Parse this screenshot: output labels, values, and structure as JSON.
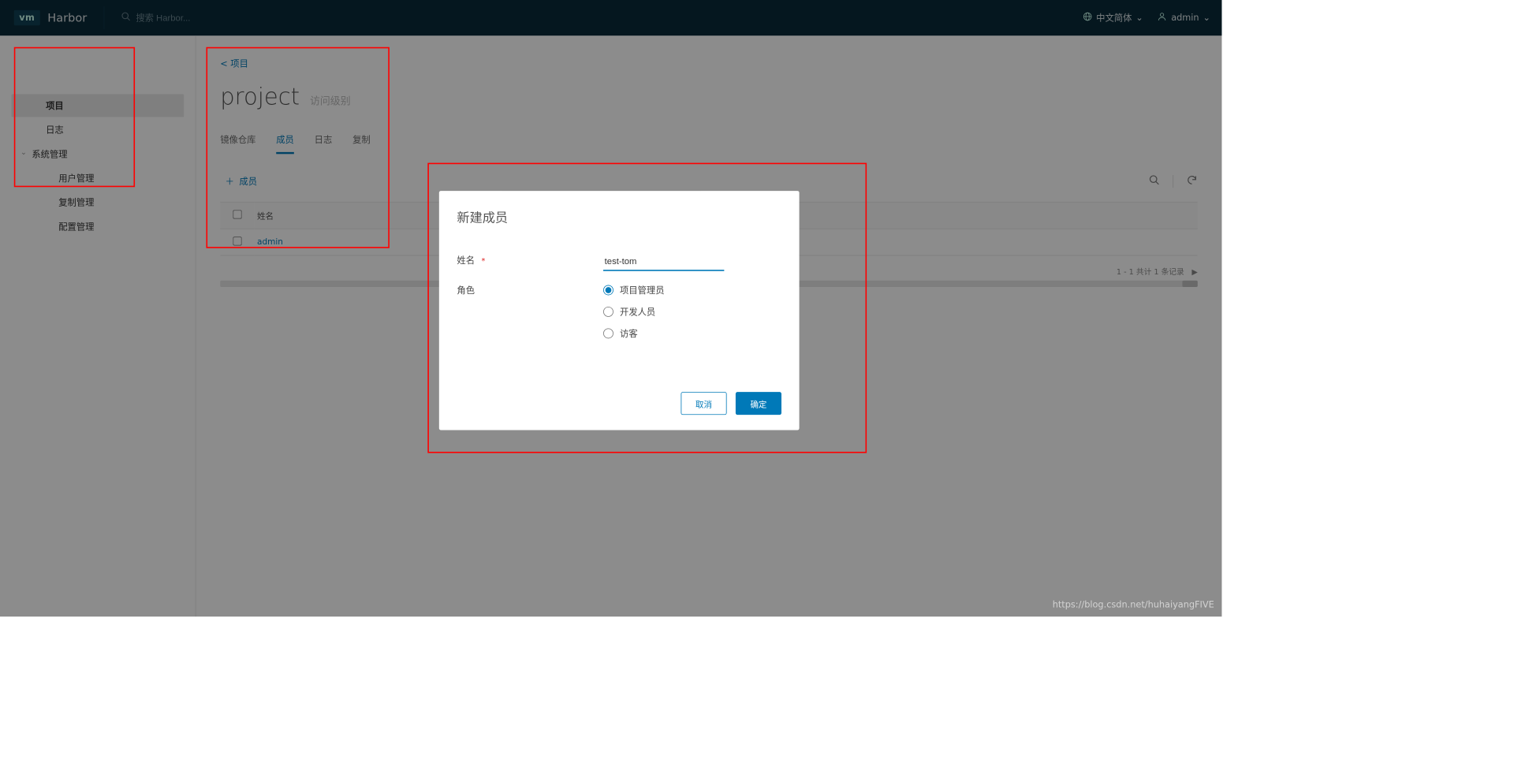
{
  "header": {
    "logo_text": "vm",
    "app_title": "Harbor",
    "search_placeholder": "搜索 Harbor...",
    "lang_label": "中文简体",
    "user_label": "admin"
  },
  "sidebar": {
    "items": {
      "projects": "项目",
      "logs": "日志",
      "admin_group": "系统管理",
      "user_mgmt": "用户管理",
      "replication": "复制管理",
      "config": "配置管理"
    }
  },
  "main": {
    "breadcrumb_back": "< 项目",
    "project_name": "project",
    "project_access": "访问级别",
    "tabs": {
      "repos": "镜像仓库",
      "members": "成员",
      "logs": "日志",
      "replication": "复制"
    },
    "add_member_label": "成员",
    "table": {
      "col_name": "姓名",
      "rows": [
        {
          "name": "admin"
        }
      ]
    },
    "pagination_text": "1 - 1 共计 1 条记录"
  },
  "modal": {
    "title": "新建成员",
    "name_label": "姓名",
    "name_value": "test-tom",
    "role_label": "角色",
    "roles": {
      "admin": "项目管理员",
      "developer": "开发人员",
      "guest": "访客"
    },
    "cancel": "取消",
    "ok": "确定"
  },
  "watermark": "https://blog.csdn.net/huhaiyangFIVE",
  "colors": {
    "accent": "#0079b8",
    "header_bg": "#0a2a3a",
    "highlight": "#ff0000"
  }
}
